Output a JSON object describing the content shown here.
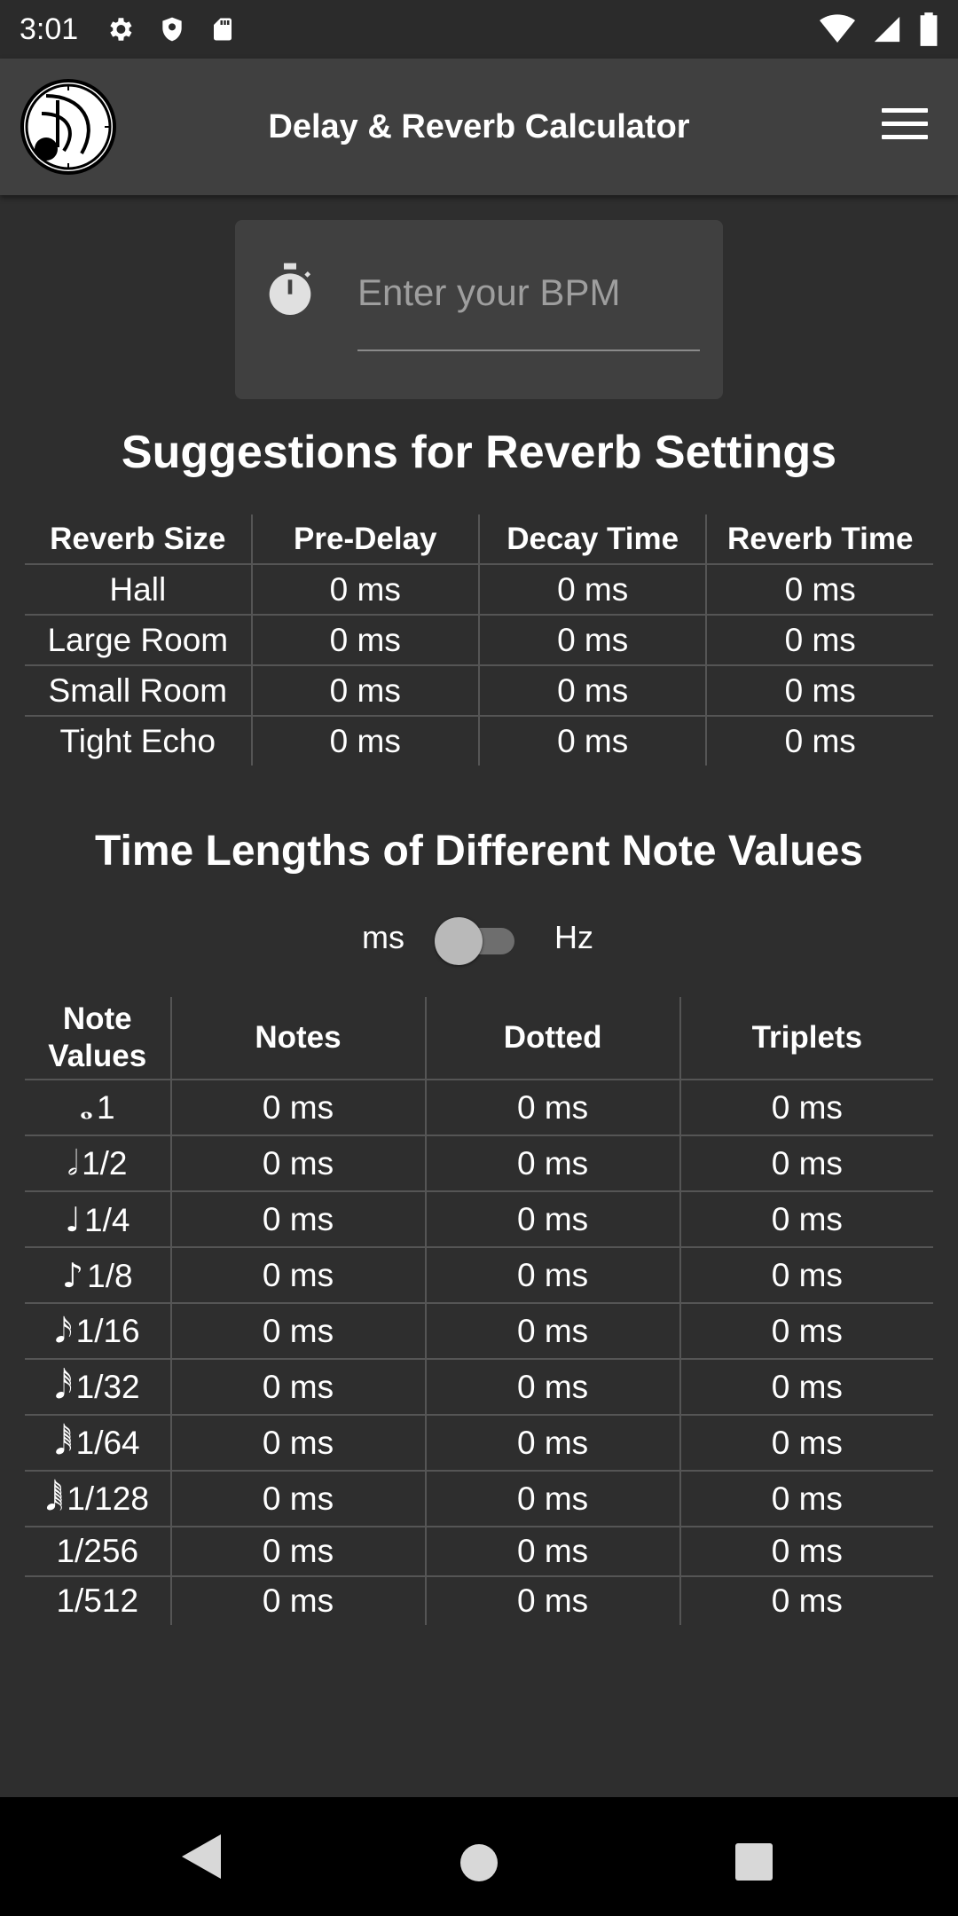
{
  "status_bar": {
    "time": "3:01"
  },
  "app_bar": {
    "title": "Delay & Reverb Calculator"
  },
  "bpm": {
    "placeholder": "Enter your BPM"
  },
  "reverb": {
    "title": "Suggestions for Reverb Settings",
    "headers": [
      "Reverb Size",
      "Pre-Delay",
      "Decay Time",
      "Reverb Time"
    ],
    "rows": [
      [
        "Hall",
        "0 ms",
        "0 ms",
        "0 ms"
      ],
      [
        "Large Room",
        "0 ms",
        "0 ms",
        "0 ms"
      ],
      [
        "Small Room",
        "0 ms",
        "0 ms",
        "0 ms"
      ],
      [
        "Tight Echo",
        "0 ms",
        "0 ms",
        "0 ms"
      ]
    ]
  },
  "notes": {
    "title": "Time Lengths of Different Note Values",
    "toggle": {
      "left_label": "ms",
      "right_label": "Hz",
      "state": "off"
    },
    "headers": [
      "Note\nValues",
      "Notes",
      "Dotted",
      "Triplets"
    ],
    "header_line1": "Note",
    "header_line2": "Values",
    "rows": [
      {
        "glyph": "𝅝",
        "value": "1",
        "notes": "0 ms",
        "dotted": "0 ms",
        "triplets": "0 ms"
      },
      {
        "glyph": "𝅗𝅥",
        "value": "1/2",
        "notes": "0 ms",
        "dotted": "0 ms",
        "triplets": "0 ms"
      },
      {
        "glyph": "♩",
        "value": "1/4",
        "notes": "0 ms",
        "dotted": "0 ms",
        "triplets": "0 ms"
      },
      {
        "glyph": "♪",
        "value": "1/8",
        "notes": "0 ms",
        "dotted": "0 ms",
        "triplets": "0 ms"
      },
      {
        "glyph": "𝅘𝅥𝅯",
        "value": "1/16",
        "notes": "0 ms",
        "dotted": "0 ms",
        "triplets": "0 ms"
      },
      {
        "glyph": "𝅘𝅥𝅰",
        "value": "1/32",
        "notes": "0 ms",
        "dotted": "0 ms",
        "triplets": "0 ms"
      },
      {
        "glyph": "𝅘𝅥𝅱",
        "value": "1/64",
        "notes": "0 ms",
        "dotted": "0 ms",
        "triplets": "0 ms"
      },
      {
        "glyph": "𝅘𝅥𝅲",
        "value": "1/128",
        "notes": "0 ms",
        "dotted": "0 ms",
        "triplets": "0 ms"
      },
      {
        "glyph": "",
        "value": "1/256",
        "notes": "0 ms",
        "dotted": "0 ms",
        "triplets": "0 ms"
      },
      {
        "glyph": "",
        "value": "1/512",
        "notes": "0 ms",
        "dotted": "0 ms",
        "triplets": "0 ms"
      }
    ]
  },
  "icons": {
    "status_left": [
      "settings-icon",
      "shield-icon",
      "sd-card-icon"
    ],
    "status_right": [
      "wifi-icon",
      "signal-icon",
      "battery-icon"
    ],
    "app": [
      "app-logo-icon",
      "menu-icon",
      "stopwatch-icon"
    ],
    "nav": [
      "back-icon",
      "home-icon",
      "recents-icon"
    ]
  },
  "colors": {
    "background": "#2e2e2e",
    "app_bar": "#404040",
    "card": "#404040",
    "divider": "#555555",
    "placeholder": "#9e9e9e",
    "nav_bar": "#000000"
  }
}
